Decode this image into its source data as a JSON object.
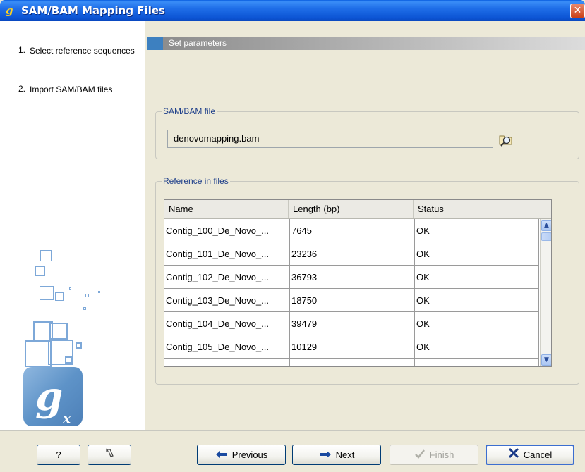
{
  "window": {
    "title": "SAM/BAM Mapping Files",
    "close_glyph": "✕",
    "app_icon_text": "g"
  },
  "steps": [
    {
      "num": "1.",
      "label": "Select reference sequences"
    },
    {
      "num": "2.",
      "label": "Import SAM/BAM files"
    }
  ],
  "logo": {
    "main": "g",
    "sub": "x"
  },
  "section": {
    "title": "Set parameters"
  },
  "sam_group": {
    "title": "SAM/BAM file",
    "file_value": "denovomapping.bam",
    "browse_icon": "browse-folder-icon"
  },
  "ref_group": {
    "title": "Reference in files"
  },
  "table": {
    "columns": [
      "Name",
      "Length (bp)",
      "Status"
    ],
    "rows": [
      {
        "name": "Contig_100_De_Novo_...",
        "length": "7645",
        "status": "OK"
      },
      {
        "name": "Contig_101_De_Novo_...",
        "length": "23236",
        "status": "OK"
      },
      {
        "name": "Contig_102_De_Novo_...",
        "length": "36793",
        "status": "OK"
      },
      {
        "name": "Contig_103_De_Novo_...",
        "length": "18750",
        "status": "OK"
      },
      {
        "name": "Contig_104_De_Novo_...",
        "length": "39479",
        "status": "OK"
      },
      {
        "name": "Contig_105_De_Novo_...",
        "length": "10129",
        "status": "OK"
      }
    ]
  },
  "buttons": {
    "help": "?",
    "reset_icon": "reset-icon",
    "previous": "Previous",
    "next": "Next",
    "finish": "Finish",
    "cancel": "Cancel"
  },
  "colors": {
    "title_bar": "#1f6ee8",
    "accent": "#3d80c0",
    "group_title": "#1e3f8a"
  }
}
